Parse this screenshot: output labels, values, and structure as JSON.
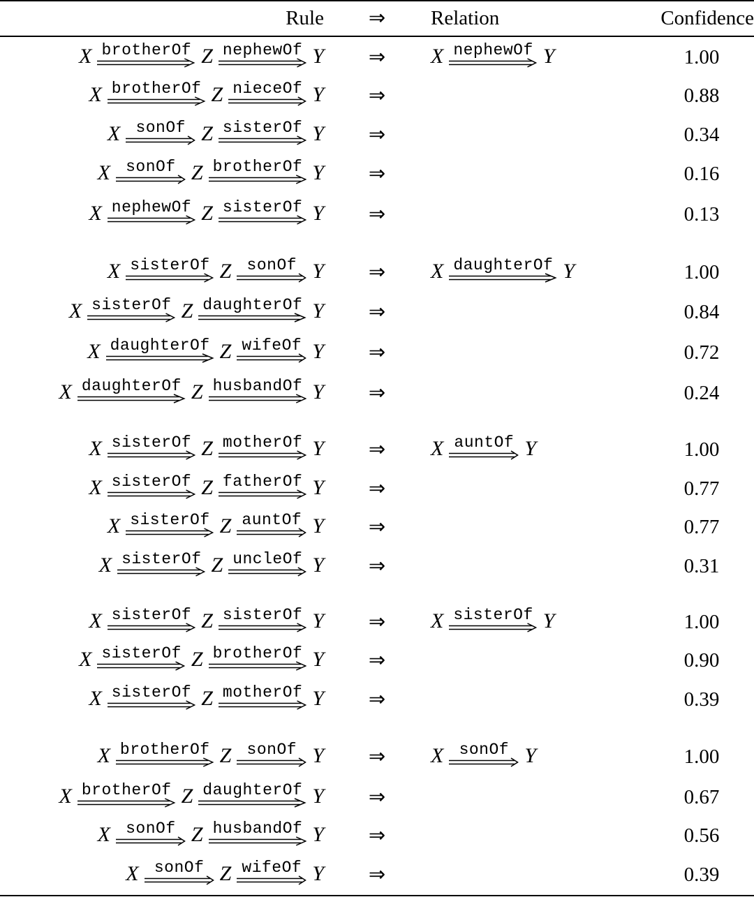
{
  "table": {
    "headers": {
      "rule": "Rule",
      "implies": "⇒",
      "relation": "Relation",
      "confidence": "Confidence"
    },
    "implies_symbol": "⇒",
    "variables": {
      "x": "X",
      "z": "Z",
      "y": "Y"
    },
    "groups": [
      {
        "relation": "nephewOf",
        "rules": [
          {
            "r1": "brotherOf",
            "r2": "nephewOf",
            "confidence": "1.00"
          },
          {
            "r1": "brotherOf",
            "r2": "nieceOf",
            "confidence": "0.88"
          },
          {
            "r1": "sonOf",
            "r2": "sisterOf",
            "confidence": "0.34"
          },
          {
            "r1": "sonOf",
            "r2": "brotherOf",
            "confidence": "0.16"
          },
          {
            "r1": "nephewOf",
            "r2": "sisterOf",
            "confidence": "0.13"
          }
        ]
      },
      {
        "relation": "daughterOf",
        "rules": [
          {
            "r1": "sisterOf",
            "r2": "sonOf",
            "confidence": "1.00"
          },
          {
            "r1": "sisterOf",
            "r2": "daughterOf",
            "confidence": "0.84"
          },
          {
            "r1": "daughterOf",
            "r2": "wifeOf",
            "confidence": "0.72"
          },
          {
            "r1": "daughterOf",
            "r2": "husbandOf",
            "confidence": "0.24"
          }
        ]
      },
      {
        "relation": "auntOf",
        "rules": [
          {
            "r1": "sisterOf",
            "r2": "motherOf",
            "confidence": "1.00"
          },
          {
            "r1": "sisterOf",
            "r2": "fatherOf",
            "confidence": "0.77"
          },
          {
            "r1": "sisterOf",
            "r2": "auntOf",
            "confidence": "0.77"
          },
          {
            "r1": "sisterOf",
            "r2": "uncleOf",
            "confidence": "0.31"
          }
        ]
      },
      {
        "relation": "sisterOf",
        "rules": [
          {
            "r1": "sisterOf",
            "r2": "sisterOf",
            "confidence": "1.00"
          },
          {
            "r1": "sisterOf",
            "r2": "brotherOf",
            "confidence": "0.90"
          },
          {
            "r1": "sisterOf",
            "r2": "motherOf",
            "confidence": "0.39"
          }
        ]
      },
      {
        "relation": "sonOf",
        "rules": [
          {
            "r1": "brotherOf",
            "r2": "sonOf",
            "confidence": "1.00"
          },
          {
            "r1": "brotherOf",
            "r2": "daughterOf",
            "confidence": "0.67"
          },
          {
            "r1": "sonOf",
            "r2": "husbandOf",
            "confidence": "0.56"
          },
          {
            "r1": "sonOf",
            "r2": "wifeOf",
            "confidence": "0.39"
          }
        ]
      }
    ]
  }
}
